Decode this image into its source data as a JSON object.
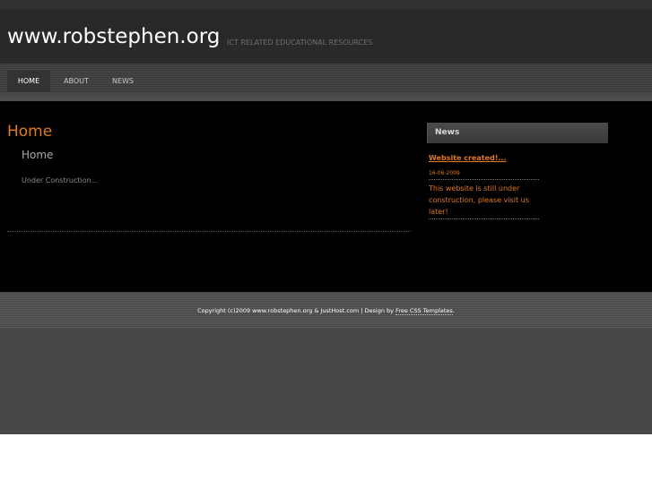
{
  "header": {
    "site_title": "www.robstephen.org",
    "slogan": "ICT RELATED EDUCATIONAL RESOURCES"
  },
  "menu": {
    "items": [
      {
        "label": "HOME",
        "active": true
      },
      {
        "label": "ABOUT",
        "active": false
      },
      {
        "label": "NEWS",
        "active": false
      }
    ]
  },
  "main": {
    "heading": "Home",
    "subheading": "Home",
    "body": "Under Construction..."
  },
  "sidebar": {
    "title": "News",
    "news": [
      {
        "headline": "Website created!...",
        "date": "16-06-2009",
        "body": "This website is still under construction, please visit us later!"
      }
    ]
  },
  "footer": {
    "copyright": "Copyright (c)2009 www.robstephen.org & JustHost.com | Design by ",
    "design_link": "Free CSS Templates",
    "suffix": "."
  },
  "colors": {
    "accent": "#e07a1f",
    "header_bg": "#292929",
    "content_bg": "#000000",
    "footer_bg": "#505050"
  }
}
